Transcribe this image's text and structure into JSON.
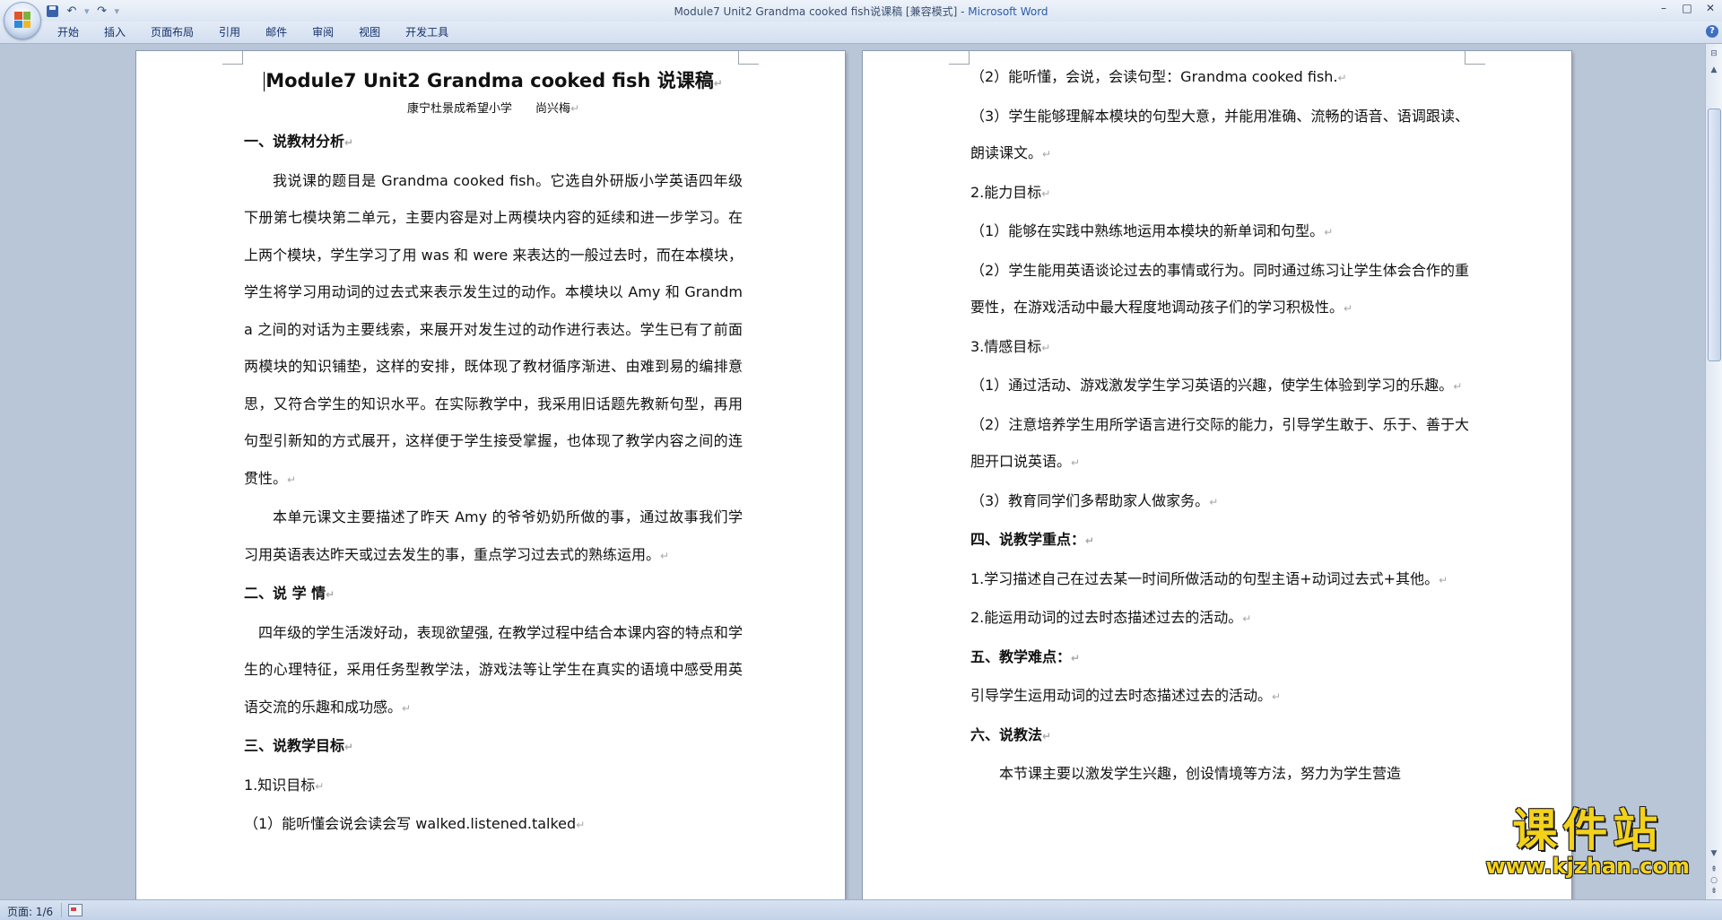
{
  "window": {
    "title_doc": "Module7 Unit2 Grandma cooked fish说课稿 [兼容模式] - ",
    "title_app": "Microsoft Word",
    "minimize": "–",
    "maximize": "□",
    "close": "✕"
  },
  "qat": {
    "undo": "↶",
    "redo": "↷",
    "customize": "▾"
  },
  "ribbon": {
    "tabs": [
      "开始",
      "插入",
      "页面布局",
      "引用",
      "邮件",
      "审阅",
      "视图",
      "开发工具"
    ],
    "help": "?"
  },
  "paragraph_mark": "↵",
  "page1": {
    "title": "Module7 Unit2 Grandma cooked fish 说课稿",
    "subtitle": "康宁杜景成希望小学　　尚兴梅",
    "paragraphs": [
      "一、说教材分析",
      "我说课的题目是 Grandma cooked fish。它选自外研版小学英语四年级下册第七模块第二单元，主要内容是对上两模块内容的延续和进一步学习。在上两个模块，学生学习了用 was 和 were 来表达的一般过去时，而在本模块，学生将学习用动词的过去式来表示发生过的动作。本模块以 Amy 和 Grandma 之间的对话为主要线索，来展开对发生过的动作进行表达。学生已有了前面两模块的知识铺垫，这样的安排，既体现了教材循序渐进、由难到易的编排意思，又符合学生的知识水平。在实际教学中，我采用旧话题先教新句型，再用句型引新知的方式展开，这样便于学生接受掌握，也体现了教学内容之间的连贯性。",
      "本单元课文主要描述了昨天 Amy 的爷爷奶奶所做的事，通过故事我们学习用英语表达昨天或过去发生的事，重点学习过去式的熟练运用。",
      "二、说 学 情",
      "四年级的学生活泼好动，表现欲望强, 在教学过程中结合本课内容的特点和学生的心理特征，采用任务型教学法，游戏法等让学生在真实的语境中感受用英语交流的乐趣和成功感。",
      "三、说教学目标",
      "1.知识目标",
      "（1）能听懂会说会读会写 walked.listened.talked"
    ]
  },
  "page2": {
    "paragraphs": [
      "（2）能听懂，会说，会读句型：Grandma cooked fish.",
      "（3）学生能够理解本模块的句型大意，并能用准确、流畅的语音、语调跟读、朗读课文。",
      "2.能力目标",
      "（1）能够在实践中熟练地运用本模块的新单词和句型。",
      "（2）学生能用英语谈论过去的事情或行为。同时通过练习让学生体会合作的重要性，在游戏活动中最大程度地调动孩子们的学习积极性。",
      "3.情感目标",
      "（1）通过活动、游戏激发学生学习英语的兴趣，使学生体验到学习的乐趣。",
      "（2）注意培养学生用所学语言进行交际的能力，引导学生敢于、乐于、善于大胆开口说英语。",
      "（3）教育同学们多帮助家人做家务。",
      "四、说教学重点：",
      "1.学习描述自己在过去某一时间所做活动的句型主语+动词过去式+其他。",
      "2.能运用动词的过去时态描述过去的活动。",
      "五、教学难点：",
      "引导学生运用动词的过去时态描述过去的活动。",
      "六、说教法",
      "本节课主要以激发学生兴趣，创设情境等方法，努力为学生营造"
    ]
  },
  "statusbar": {
    "page_info": "页面: 1/6"
  },
  "watermark": {
    "text": "课件站",
    "url": "www.kjzhan.com"
  },
  "scrollbar": {
    "up": "▲",
    "down": "▼"
  }
}
